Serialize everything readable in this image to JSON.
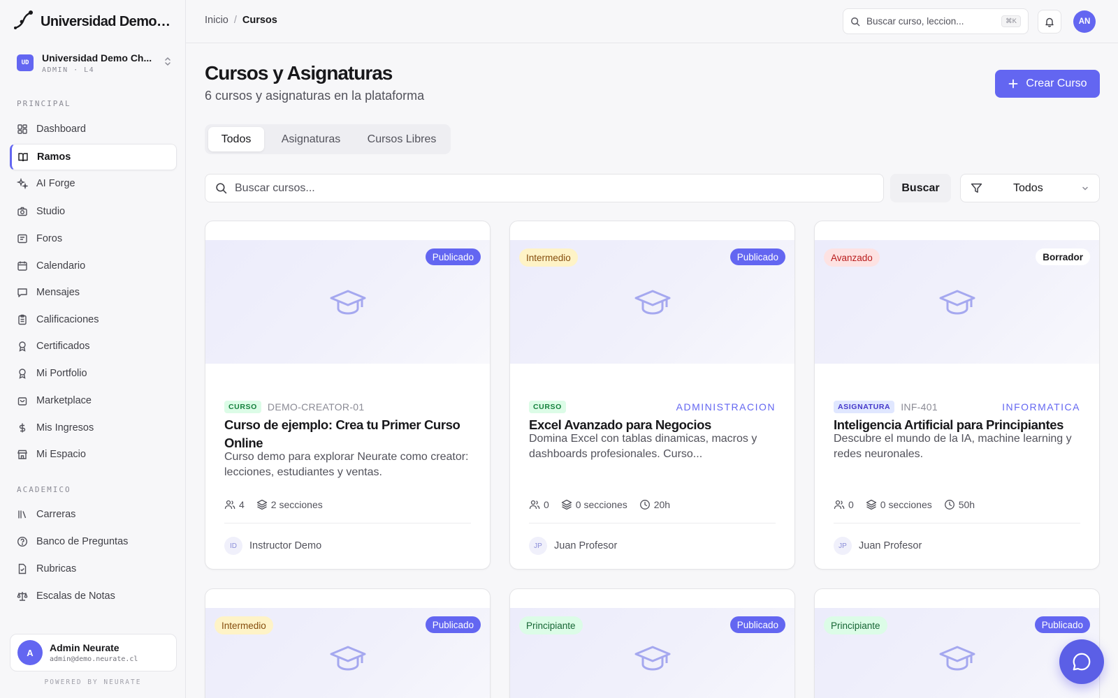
{
  "brand": {
    "name": "Universidad Demo Ch..."
  },
  "org": {
    "badge": "UD",
    "name": "Universidad Demo Ch...",
    "role": "ADMIN · L4"
  },
  "sidebar": {
    "section_principal": "PRINCIPAL",
    "section_academico": "ACADEMICO",
    "items": [
      {
        "label": "Dashboard",
        "icon": "grid-icon"
      },
      {
        "label": "Ramos",
        "icon": "book-icon",
        "active": true
      },
      {
        "label": "AI Forge",
        "icon": "sparkles-icon"
      },
      {
        "label": "Studio",
        "icon": "camera-icon"
      },
      {
        "label": "Foros",
        "icon": "forum-icon"
      },
      {
        "label": "Calendario",
        "icon": "calendar-icon"
      },
      {
        "label": "Mensajes",
        "icon": "message-icon"
      },
      {
        "label": "Calificaciones",
        "icon": "clipboard-icon"
      },
      {
        "label": "Certificados",
        "icon": "award-icon"
      },
      {
        "label": "Mi Portfolio",
        "icon": "award-icon"
      },
      {
        "label": "Marketplace",
        "icon": "bag-icon"
      },
      {
        "label": "Mis Ingresos",
        "icon": "dollar-icon"
      },
      {
        "label": "Mi Espacio",
        "icon": "store-icon"
      }
    ],
    "academic_items": [
      {
        "label": "Carreras",
        "icon": "library-icon"
      },
      {
        "label": "Banco de Preguntas",
        "icon": "help-circle-icon"
      },
      {
        "label": "Rubricas",
        "icon": "file-check-icon"
      },
      {
        "label": "Escalas de Notas",
        "icon": "scale-icon"
      }
    ]
  },
  "user": {
    "initial": "A",
    "name": "Admin Neurate",
    "email": "admin@demo.neurate.cl"
  },
  "powered_by": "POWERED BY NEURATE",
  "topbar": {
    "breadcrumb_home": "Inicio",
    "breadcrumb_sep": "/",
    "breadcrumb_current": "Cursos",
    "search_placeholder": "Buscar curso, leccion...",
    "search_shortcut": "⌘K",
    "avatar_initials": "AN"
  },
  "page": {
    "title": "Cursos y Asignaturas",
    "subtitle": "6 cursos y asignaturas en la plataforma",
    "create_label": "Crear Curso"
  },
  "tabs": [
    {
      "label": "Todos",
      "active": true
    },
    {
      "label": "Asignaturas"
    },
    {
      "label": "Cursos Libres"
    }
  ],
  "filters": {
    "search_placeholder": "Buscar cursos...",
    "search_button": "Buscar",
    "select_value": "Todos"
  },
  "courses": [
    {
      "status": "Publicado",
      "level": "",
      "type": "CURSO",
      "code": "DEMO-CREATOR-01",
      "category": "",
      "title": "Curso de ejemplo: Crea tu Primer Curso Online",
      "description": "Curso demo para explorar Neurate como creator: lecciones, estudiantes y ventas.",
      "students": "4",
      "sections": "2 secciones",
      "duration": "",
      "instructor_initials": "ID",
      "instructor": "Instructor Demo"
    },
    {
      "status": "Publicado",
      "level": "Intermedio",
      "type": "CURSO",
      "code": "",
      "category": "ADMINISTRACION",
      "title": "Excel Avanzado para Negocios",
      "description": "Domina Excel con tablas dinamicas, macros y dashboards profesionales. Curso...",
      "students": "0",
      "sections": "0 secciones",
      "duration": "20h",
      "instructor_initials": "JP",
      "instructor": "Juan Profesor"
    },
    {
      "status": "Borrador",
      "level": "Avanzado",
      "type": "ASIGNATURA",
      "code": "INF-401",
      "category": "INFORMATICA",
      "title": "Inteligencia Artificial para Principiantes",
      "description": "Descubre el mundo de la IA, machine learning y redes neuronales.",
      "students": "0",
      "sections": "0 secciones",
      "duration": "50h",
      "instructor_initials": "JP",
      "instructor": "Juan Profesor"
    },
    {
      "status": "Publicado",
      "level": "Intermedio"
    },
    {
      "status": "Publicado",
      "level": "Principiante"
    },
    {
      "status": "Publicado",
      "level": "Principiante"
    }
  ],
  "colors": {
    "accent": "#6366f1",
    "level_intermediate": "#fef3c7",
    "level_advanced": "#fde2e2",
    "level_beginner": "#dcfce7"
  }
}
